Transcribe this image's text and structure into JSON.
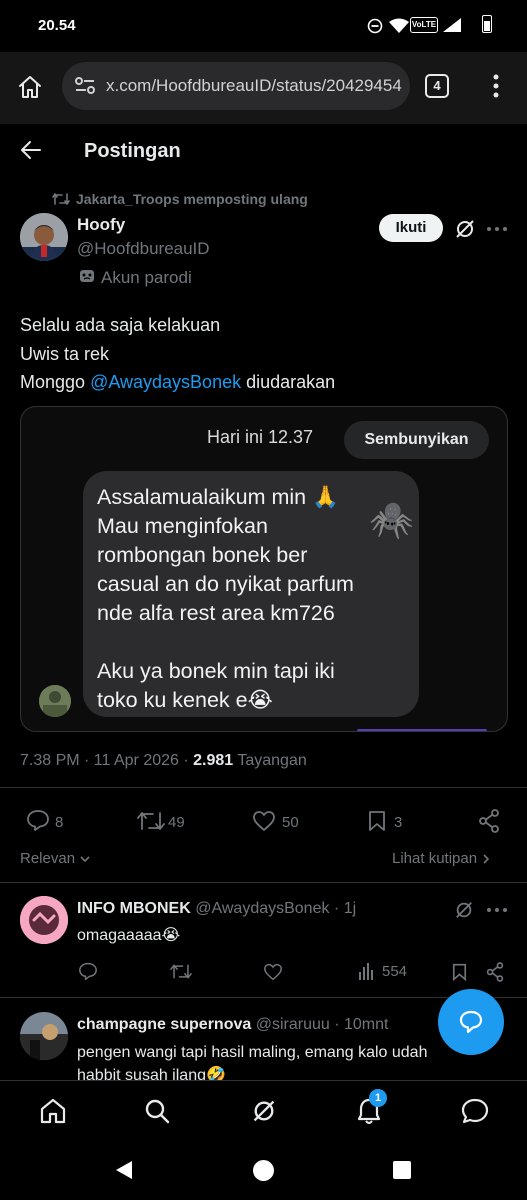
{
  "status_bar": {
    "time": "20.54"
  },
  "browser": {
    "url": "x.com/HoofdbureauID/status/20429454",
    "tab_count": "4"
  },
  "header": {
    "title": "Postingan"
  },
  "post": {
    "repost_label": "Jakarta_Troops memposting ulang",
    "author_name": "Hoofy",
    "author_handle": "@HoofdbureauID",
    "follow_label": "Ikuti",
    "parody_label": "Akun parodi",
    "text_line1": "Selalu ada saja kelakuan",
    "text_line2": "Uwis ta rek",
    "text_line3_prefix": "Monggo ",
    "text_line3_mention": "@AwaydaysBonek",
    "text_line3_suffix": " diudarakan",
    "media": {
      "timestamp": "Hari ini 12.37",
      "hide_label": "Sembunyikan",
      "message": "Assalamualaikum min 🙏\nMau menginfokan\nrombongan bonek ber\ncasual an do nyikat parfum\nnde alfa rest area km726\n\nAku ya bonek min tapi iki\ntoko ku kenek e😭"
    },
    "meta_time": "7.38 PM · 11 Apr 2026 · ",
    "meta_views_count": "2.981",
    "meta_views_label": " Tayangan",
    "replies": "8",
    "reposts": "49",
    "likes": "50",
    "bookmarks": "3"
  },
  "sort": {
    "label": "Relevan",
    "quotes_label": "Lihat kutipan"
  },
  "replies": [
    {
      "name": "INFO MBONEK",
      "handle": "@AwaydaysBonek · 1j",
      "text": "omagaaaaa😭",
      "views": "554"
    },
    {
      "name": "champagne supernova",
      "handle": "@siraruuu · 10mnt",
      "text": "pengen wangi tapi hasil maling, emang kalo udah habbit susah ilang🤣"
    }
  ],
  "nav": {
    "notification_count": "1"
  },
  "colors": {
    "accent": "#1d9bf0",
    "background": "#000000",
    "text": "#e7e9ea",
    "muted": "#71767b"
  }
}
